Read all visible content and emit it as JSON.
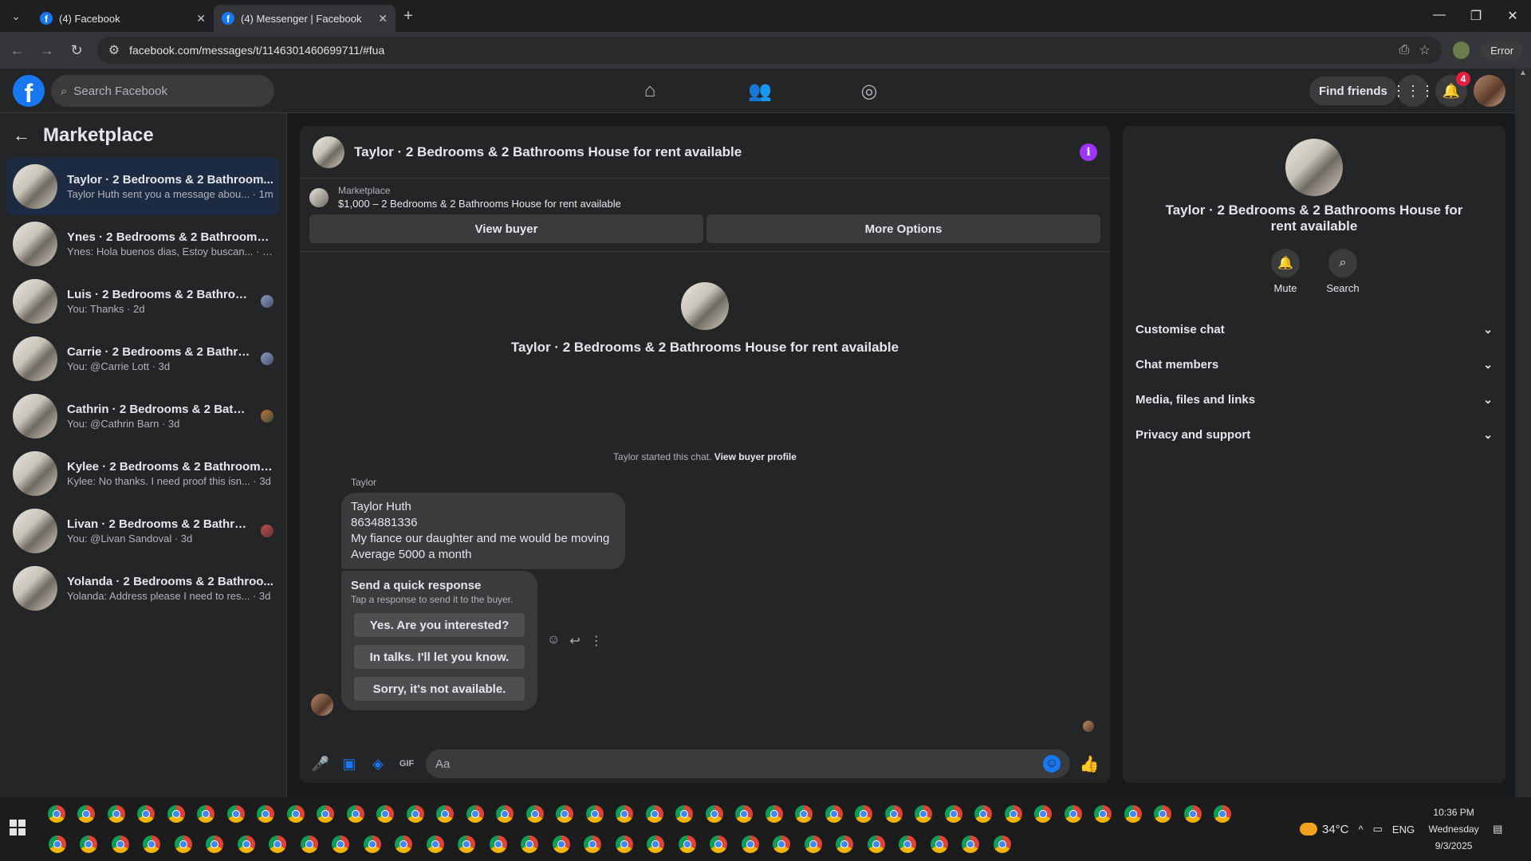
{
  "browser": {
    "tabs": [
      {
        "title": "(4) Facebook",
        "active": false
      },
      {
        "title": "(4) Messenger | Facebook",
        "active": true
      }
    ],
    "url": "facebook.com/messages/t/1146301460699711/#fua",
    "error_label": "Error"
  },
  "fb": {
    "search_placeholder": "Search Facebook",
    "find_friends": "Find friends",
    "notification_count": "4"
  },
  "sidebar": {
    "title": "Marketplace",
    "conversations": [
      {
        "name": "Taylor · 2 Bedrooms & 2 Bathroom...",
        "preview": "Taylor Huth sent you a message abou... · 1m"
      },
      {
        "name": "Ynes · 2 Bedrooms & 2 Bathrooms ...",
        "preview": "Ynes: Hola buenos dias, Estoy buscan... · 2d"
      },
      {
        "name": "Luis · 2 Bedrooms & 2 Bathroom...",
        "preview": "You: Thanks · 2d"
      },
      {
        "name": "Carrie · 2 Bedrooms & 2 Bathroo...",
        "preview": "You: @Carrie Lott · 3d"
      },
      {
        "name": "Cathrin · 2 Bedrooms & 2 Bathr...",
        "preview": "You: @Cathrin Barn · 3d"
      },
      {
        "name": "Kylee · 2 Bedrooms & 2 Bathrooms...",
        "preview": "Kylee: No thanks. I need proof this isn... · 3d"
      },
      {
        "name": "Livan · 2 Bedrooms & 2 Bathroo...",
        "preview": "You: @Livan Sandoval · 3d"
      },
      {
        "name": "Yolanda · 2 Bedrooms & 2 Bathroo...",
        "preview": "Yolanda: Address please I need to res... · 3d"
      }
    ]
  },
  "chat": {
    "title": "Taylor · 2 Bedrooms & 2 Bathrooms House for rent available",
    "marketplace_label": "Marketplace",
    "listing": "$1,000 – 2 Bedrooms & 2 Bathrooms House for rent available",
    "view_buyer": "View buyer",
    "more_options": "More Options",
    "intro_title": "Taylor · 2 Bedrooms & 2 Bathrooms House for rent available",
    "started_text": "Taylor started this chat.",
    "view_buyer_profile": "View buyer profile",
    "sender": "Taylor",
    "message_lines": [
      "Taylor Huth",
      "8634881336",
      "My fiance our daughter and me would be moving",
      "Average 5000 a month"
    ],
    "quick_title": "Send a quick response",
    "quick_subtitle": "Tap a response to send it to the buyer.",
    "quick_replies": [
      "Yes. Are you interested?",
      "In talks. I'll let you know.",
      "Sorry, it's not available."
    ],
    "composer_placeholder": "Aa"
  },
  "details": {
    "title": "Taylor · 2 Bedrooms & 2 Bathrooms House for rent available",
    "actions": [
      {
        "label": "Mute",
        "icon": "bell-icon"
      },
      {
        "label": "Search",
        "icon": "search-icon"
      }
    ],
    "sections": [
      "Customise chat",
      "Chat members",
      "Media, files and links",
      "Privacy and support"
    ]
  },
  "taskbar": {
    "temperature": "34°C",
    "language": "ENG",
    "time": "10:36 PM",
    "day": "Wednesday",
    "date": "9/3/2025"
  }
}
